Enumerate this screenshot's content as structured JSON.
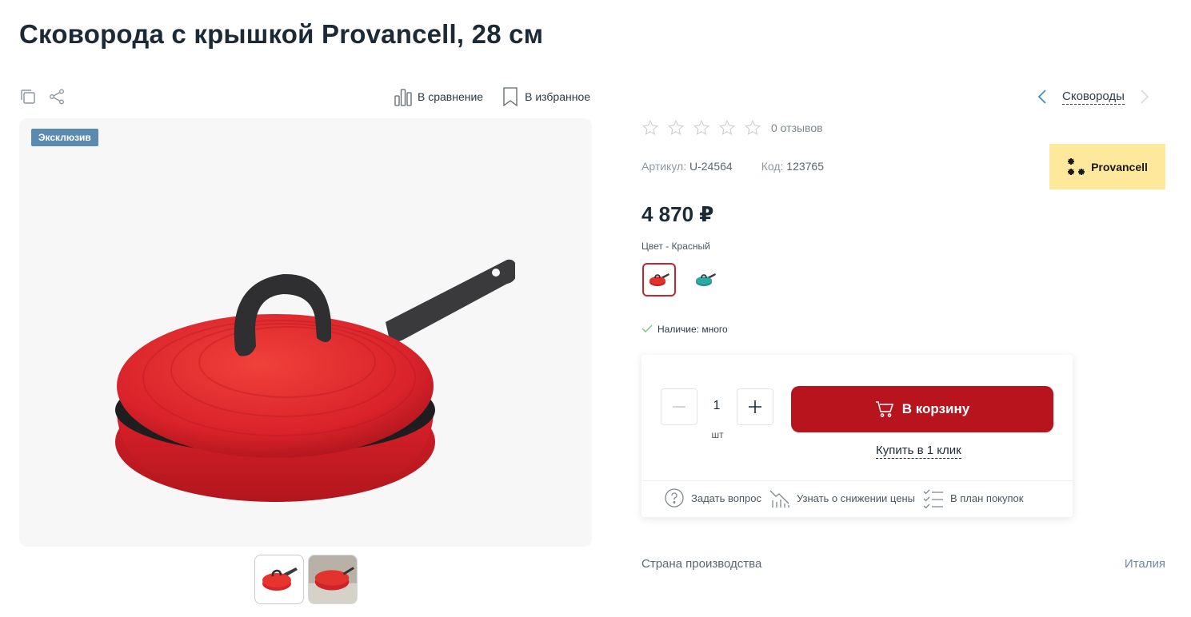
{
  "product": {
    "title": "Сковорода с крышкой Provancell, 28 см",
    "badge": "Эксклюзив",
    "reviews": "0 отзывов",
    "article_label": "Артикул:",
    "article_value": "U-24564",
    "code_label": "Код:",
    "code_value": "123765",
    "price": "4 870 ₽",
    "color_label": "Цвет - Красный",
    "stock": "Наличие: много",
    "brand": "Provancell",
    "rating": 0
  },
  "toolbar": {
    "compare": "В сравнение",
    "favorite": "В избранное"
  },
  "breadcrumb": {
    "category": "Сковороды"
  },
  "buy": {
    "quantity": "1",
    "unit": "шт",
    "cart_button": "В корзину",
    "one_click": "Купить в 1 клик",
    "ask_question": "Задать вопрос",
    "price_drop": "Узнать о снижении цены",
    "purchase_plan": "В план покупок"
  },
  "specs": {
    "country_label": "Страна производства",
    "country_value": "Италия"
  },
  "colors": {
    "accent": "#b7141e",
    "product_red": "#e02a2a",
    "swatch_teal": "#2fa6a8",
    "brand_bg": "#fde89b",
    "badge_bg": "#5b8ab0"
  }
}
